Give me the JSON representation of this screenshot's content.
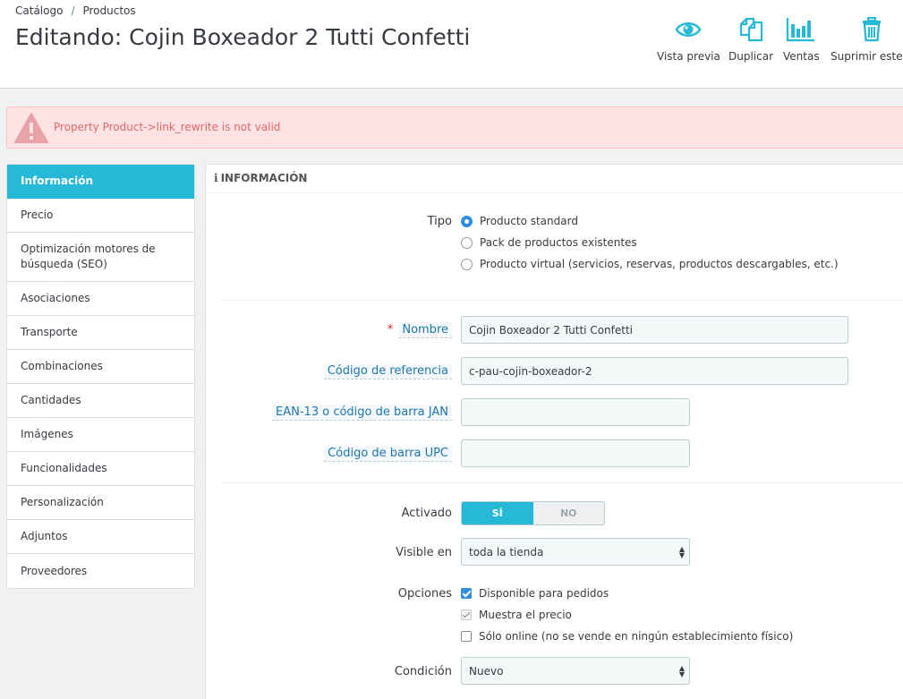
{
  "breadcrumb": {
    "item1": "Catálogo",
    "separator": "/",
    "item2": "Productos"
  },
  "title": "Editando: Cojin Boxeador 2 Tutti Confetti",
  "toolbar": {
    "preview_label": "Vista previa",
    "duplicate_label": "Duplicar",
    "sales_label": "Ventas",
    "delete_label": "Suprimir este p",
    "icon_color": "#25b9d7"
  },
  "alert": {
    "message": "Property Product->link_rewrite is not valid",
    "color": "#d9534f"
  },
  "tabs": [
    "Información",
    "Precio",
    "Optimización motores de búsqueda (SEO)",
    "Asociaciones",
    "Transporte",
    "Combinaciones",
    "Cantidades",
    "Imágenes",
    "Funcionalidades",
    "Personalización",
    "Adjuntos",
    "Proveedores"
  ],
  "panel": {
    "heading_icon": "i",
    "heading": "INFORMACIÓN",
    "type": {
      "label": "Tipo",
      "options": [
        "Producto standard",
        "Pack de productos existentes",
        "Producto virtual (servicios, reservas, productos descargables, etc.)"
      ],
      "selected": "Producto standard"
    },
    "name": {
      "required_mark": "*",
      "label": "Nombre",
      "value": "Cojin Boxeador 2 Tutti Confetti"
    },
    "reference": {
      "label": "Código de referencia",
      "value": "c-pau-cojin-boxeador-2"
    },
    "ean13": {
      "label": "EAN-13 o código de barra JAN",
      "value": ""
    },
    "upc": {
      "label": "Código de barra UPC",
      "value": ""
    },
    "active": {
      "label": "Activado",
      "yes": "SÍ",
      "no": "NO",
      "value": "SÍ"
    },
    "visibility": {
      "label": "Visible en",
      "value": "toda la tienda"
    },
    "options": {
      "label": "Opciones",
      "items": [
        {
          "text": "Disponible para pedidos",
          "checked": true
        },
        {
          "text": "Muestra el precio",
          "checked": true,
          "disabled": true
        },
        {
          "text": "Sólo online (no se vende en ningún establecimiento físico)",
          "checked": false
        }
      ]
    },
    "condition": {
      "label": "Condición",
      "value": "Nuevo"
    }
  }
}
